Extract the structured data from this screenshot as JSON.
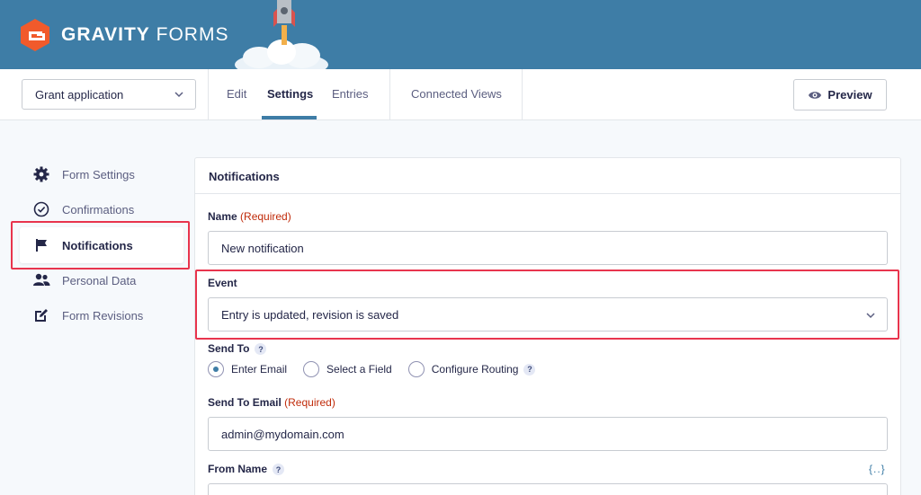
{
  "brand": {
    "name_bold": "GRAVITY",
    "name_light": "FORMS"
  },
  "header": {
    "form_select_value": "Grant application",
    "tabs": [
      {
        "label": "Edit"
      },
      {
        "label": "Settings"
      },
      {
        "label": "Entries"
      },
      {
        "label": "Connected Views"
      }
    ],
    "preview_label": "Preview"
  },
  "sidebar": {
    "items": [
      {
        "label": "Form Settings",
        "icon": "gear-icon"
      },
      {
        "label": "Confirmations",
        "icon": "check-circle-icon"
      },
      {
        "label": "Notifications",
        "icon": "flag-icon"
      },
      {
        "label": "Personal Data",
        "icon": "users-icon"
      },
      {
        "label": "Form Revisions",
        "icon": "edit-square-icon"
      }
    ]
  },
  "panel": {
    "title": "Notifications",
    "name": {
      "label": "Name",
      "required": "(Required)",
      "value": "New notification"
    },
    "event": {
      "label": "Event",
      "value": "Entry is updated, revision is saved"
    },
    "send_to": {
      "label": "Send To",
      "help": "?",
      "options": [
        {
          "label": "Enter Email",
          "selected": true
        },
        {
          "label": "Select a Field",
          "selected": false
        },
        {
          "label": "Configure Routing",
          "selected": false,
          "help": "?"
        }
      ]
    },
    "send_to_email": {
      "label": "Send To Email",
      "required": "(Required)",
      "value": "admin@mydomain.com"
    },
    "from_name": {
      "label": "From Name",
      "help": "?",
      "merge_tag": "{..}"
    }
  },
  "colors": {
    "banner": "#3e7da6",
    "highlight": "#e8344d",
    "required": "#c02b0a",
    "accent": "#3e7da6"
  }
}
